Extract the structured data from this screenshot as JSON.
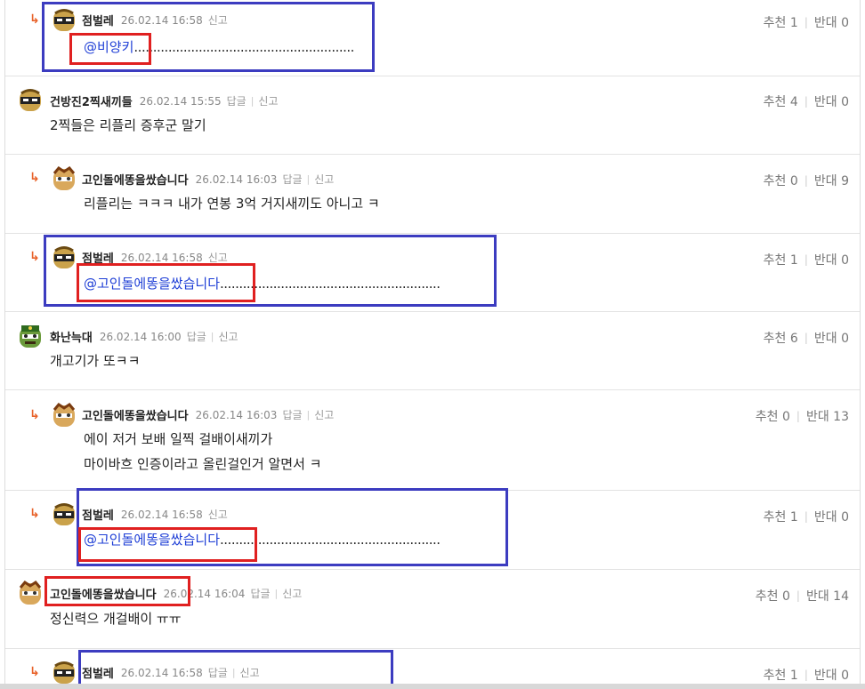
{
  "labels": {
    "reply": "답글",
    "report": "신고",
    "recommend": "추천",
    "oppose": "반대"
  },
  "comments": [
    {
      "author": "점벌레",
      "date": "26.02.14 16:58",
      "mention": "@비양키",
      "text": "",
      "dots": "..........................................................",
      "rec": "1",
      "opp": "0"
    },
    {
      "author": "건방진2찍새끼들",
      "date": "26.02.14 15:55",
      "text": "2찍들은 리플리 증후군 말기",
      "rec": "4",
      "opp": "0"
    },
    {
      "author": "고인돌에똥을쌌습니다",
      "date": "26.02.14 16:03",
      "text": "리플리는 ㅋㅋㅋ 내가 연봉 3억 거지새끼도 아니고 ㅋ",
      "rec": "0",
      "opp": "9"
    },
    {
      "author": "점벌레",
      "date": "26.02.14 16:58",
      "mention": "@고인돌에똥을쌌습니다",
      "dots": "..........................................................",
      "rec": "1",
      "opp": "0"
    },
    {
      "author": "화난늑대",
      "date": "26.02.14 16:00",
      "text": "개고기가 또ㅋㅋ",
      "rec": "6",
      "opp": "0"
    },
    {
      "author": "고인돌에똥을쌌습니다",
      "date": "26.02.14 16:03",
      "text": "에이 저거 보배 일찍 걸배이새끼가",
      "text2": "마이바흐 인증이라고 올린걸인거 알면서 ㅋ",
      "rec": "0",
      "opp": "13"
    },
    {
      "author": "점벌레",
      "date": "26.02.14 16:58",
      "mention": "@고인돌에똥을쌌습니다",
      "dots": "..........................................................",
      "rec": "1",
      "opp": "0"
    },
    {
      "author": "고인돌에똥을쌌습니다",
      "date": "26.02.14 16:04",
      "text": "정신력으 개걸배이 ㅠㅠ",
      "rec": "0",
      "opp": "14"
    },
    {
      "author": "점벌레",
      "date": "26.02.14 16:58",
      "rec": "1",
      "opp": "0"
    }
  ],
  "colors": {
    "mention": "#1f3fd6",
    "reply_arrow": "#e8622a",
    "box_blue": "#3c3cc0",
    "box_red": "#e02020"
  }
}
